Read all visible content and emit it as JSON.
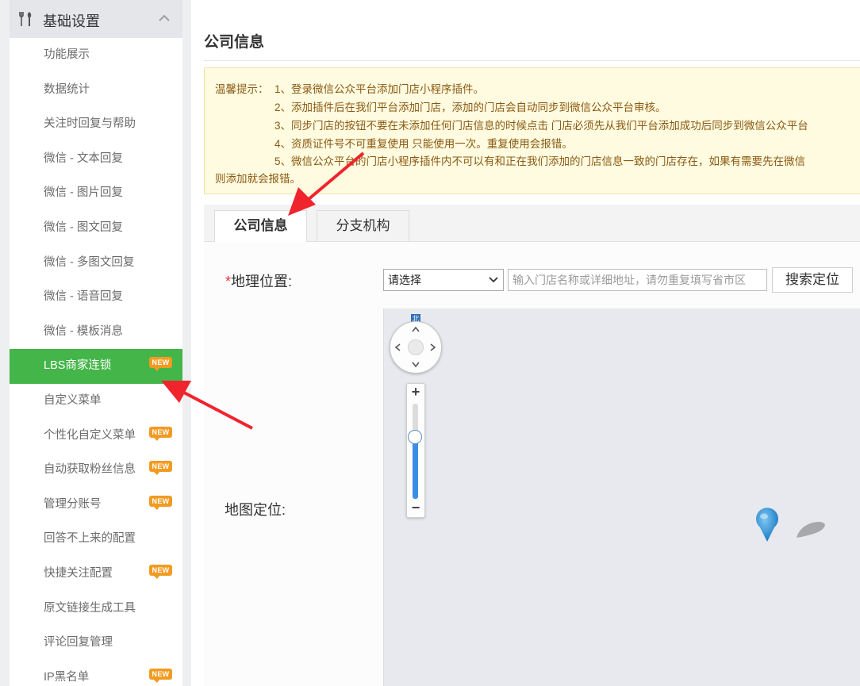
{
  "sidebar": {
    "section_title": "基础设置",
    "badge_text": "NEW",
    "items": [
      {
        "label": "功能展示"
      },
      {
        "label": "数据统计"
      },
      {
        "label": "关注时回复与帮助"
      },
      {
        "label": "微信 - 文本回复"
      },
      {
        "label": "微信 - 图片回复"
      },
      {
        "label": "微信 - 图文回复"
      },
      {
        "label": "微信 - 多图文回复"
      },
      {
        "label": "微信 - 语音回复"
      },
      {
        "label": "微信 - 模板消息"
      },
      {
        "label": "LBS商家连锁",
        "active": true,
        "new": true
      },
      {
        "label": "自定义菜单"
      },
      {
        "label": "个性化自定义菜单",
        "new": true
      },
      {
        "label": "自动获取粉丝信息",
        "new": true
      },
      {
        "label": "管理分账号",
        "new": true
      },
      {
        "label": "回答不上来的配置"
      },
      {
        "label": "快捷关注配置",
        "new": true
      },
      {
        "label": "原文链接生成工具"
      },
      {
        "label": "评论回复管理"
      },
      {
        "label": "IP黑名单",
        "new": true
      }
    ]
  },
  "main": {
    "page_title": "公司信息",
    "tips": {
      "prefix": "温馨提示：",
      "lines": [
        "1、登录微信公众平台添加门店小程序插件。",
        "2、添加插件后在我们平台添加门店，添加的门店会自动同步到微信公众平台审核。",
        "3、同步门店的按钮不要在未添加任何门店信息的时候点击 门店必须先从我们平台添加成功后同步到微信公众平台",
        "4、资质证件号不可重复使用 只能使用一次。重复使用会报错。",
        "5、微信公众平台的门店小程序插件内不可以有和正在我们添加的门店信息一致的门店存在，如果有需要先在微信",
        "则添加就会报错。"
      ]
    },
    "tabs": [
      {
        "label": "公司信息",
        "active": true
      },
      {
        "label": "分支机构",
        "active": false
      }
    ],
    "form": {
      "geo_required_mark": "*",
      "geo_label": "地理位置:",
      "region_select": "请选择",
      "address_placeholder": "输入门店名称或详细地址，请勿重复填写省市区",
      "search_button": "搜索定位",
      "map_label": "地图定位:"
    },
    "map": {
      "north_label": "北",
      "zoom_level_fraction": 0.65,
      "zoom_in": "+",
      "zoom_out": "−"
    }
  },
  "colors": {
    "active_menu": "#44b549",
    "new_badge": "#f29b22",
    "tip_background": "#fffbe0",
    "tip_text": "#8a5a13",
    "required_mark": "#ee3333",
    "map_pin": "#2e8fd6",
    "annotation_arrow": "#f0242d"
  }
}
